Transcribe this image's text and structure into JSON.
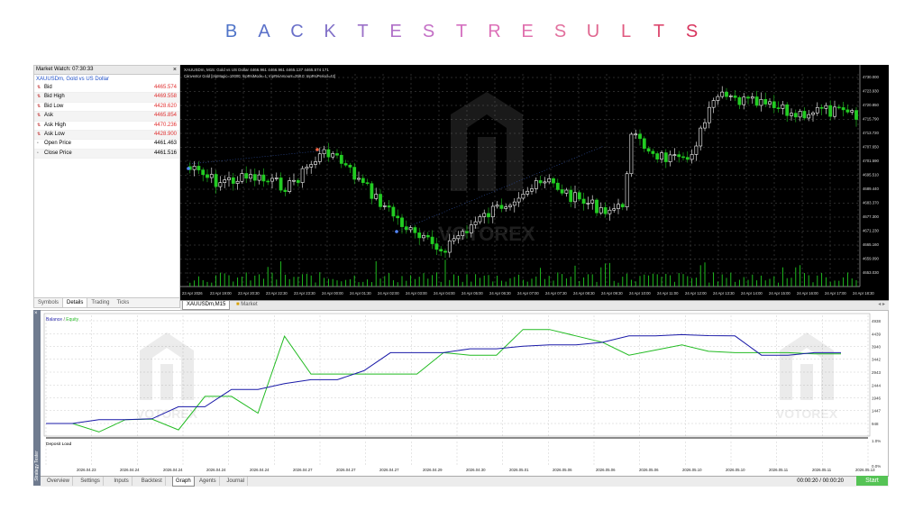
{
  "headline": "BACKTESTRESULTS",
  "headline_colors": [
    "#4f74c8",
    "#5a70c9",
    "#6a70c9",
    "#8170c8",
    "#9b70c8",
    "#b070c8",
    "#c470c6",
    "#d470c0",
    "#dc70b8",
    "#e070ae",
    "#e2709e",
    "#e06790",
    "#e05a80",
    "#dd4a70",
    "#d8355e"
  ],
  "market_watch": {
    "title": "Market Watch: 07:30:33",
    "close": "×",
    "symbol": "XAUUSDm, Gold vs US Dollar",
    "rows": [
      {
        "label": "Bid",
        "value": "4465.574",
        "red": true
      },
      {
        "label": "Bid High",
        "value": "4469.558",
        "red": true
      },
      {
        "label": "Bid Low",
        "value": "4428.620",
        "red": true
      },
      {
        "label": "Ask",
        "value": "4465.854",
        "red": true
      },
      {
        "label": "Ask High",
        "value": "4470.236",
        "red": true
      },
      {
        "label": "Ask Low",
        "value": "4428.900",
        "red": true
      },
      {
        "label": "Open Price",
        "value": "4461.463",
        "red": false
      },
      {
        "label": "Close Price",
        "value": "4461.516",
        "red": false
      }
    ],
    "tabs": [
      "Symbols",
      "Details",
      "Trading",
      "Ticks"
    ],
    "active_tab": 1
  },
  "chart": {
    "header_line1": "XAUUSDm, M15:  Gold vs US Dollar  4466.961 4466.961 4465.137 4465.574  171",
    "header_line2": "Canvestor Gold [InpMagic=10000; InpRsiMode=1; InpRsiAmount=258.0; InpRsiPeriod=42]",
    "price_labels": [
      "4730.000",
      "4723.930",
      "4720.850",
      "4715.790",
      "4713.720",
      "4707.650",
      "4701.590",
      "4695.510",
      "4689.440",
      "4683.370",
      "4677.300",
      "4671.230",
      "4665.160",
      "4659.090",
      "4653.030"
    ],
    "time_labels": [
      "23 Apr 2026",
      "23 Apr 19:00",
      "23 Apr 20:30",
      "23 Apr 22:30",
      "23 Apr 23:30",
      "24 Apr 00:00",
      "24 Apr 01:30",
      "24 Apr 02:00",
      "24 Apr 03:00",
      "24 Apr 04:00",
      "24 Apr 05:00",
      "24 Apr 06:30",
      "24 Apr 07:00",
      "24 Apr 07:30",
      "24 Apr 08:30",
      "24 Apr 09:30",
      "24 Apr 10:00",
      "24 Apr 11:00",
      "24 Apr 12:00",
      "24 Apr 13:30",
      "24 Apr 14:00",
      "24 Apr 15:00",
      "24 Apr 16:00",
      "24 Apr 17:00",
      "24 Apr 18:30"
    ],
    "tab_symbol": "XAUUSDm,M15",
    "tab_market": "Market",
    "watermark": "VOTOREX"
  },
  "tester": {
    "legend_balance": "Balance",
    "legend_sep": " / ",
    "legend_equity": "Equity",
    "deposit_load": "Deposit Load",
    "y_labels": [
      "4938",
      "4439",
      "3940",
      "3442",
      "2943",
      "2444",
      "1946",
      "1447",
      "948"
    ],
    "load_labels": [
      "1.0%",
      "0.0%"
    ],
    "dates": [
      "2026.04.23",
      "2026.04.24",
      "2026.04.24",
      "2026.04.24",
      "2026.04.24",
      "2026.04.27",
      "2026.04.27",
      "2026.04.27",
      "2026.04.29",
      "2026.04.30",
      "2026.05.01",
      "2026.05.06",
      "2026.05.06",
      "2026.05.06",
      "2026.05.10",
      "2026.05.10",
      "2026.05.11",
      "2026.05.11",
      "2026.05.13"
    ],
    "balance": [
      948,
      948,
      1100,
      1100,
      1130,
      1600,
      1600,
      2270,
      2270,
      2500,
      2650,
      2650,
      3000,
      3700,
      3700,
      3700,
      3850,
      3850,
      3950,
      4000,
      4000,
      4100,
      4350,
      4350,
      4400,
      4360,
      4350,
      3600,
      3600,
      3700,
      3700
    ],
    "equity": [
      948,
      948,
      620,
      1100,
      1120,
      700,
      2000,
      2000,
      1350,
      4340,
      2870,
      2870,
      2870,
      2870,
      2870,
      3700,
      3600,
      3600,
      4600,
      4600,
      4350,
      4100,
      3600,
      3800,
      4000,
      3750,
      3700,
      3700,
      3700,
      3650,
      3650
    ],
    "tabs": [
      "Overview",
      "Settings",
      "Inputs",
      "Backtest",
      "Graph",
      "Agents",
      "Journal"
    ],
    "active_tab": 4,
    "timer": "00:00:20 / 00:00:20",
    "start": "Start",
    "sidebar_label": "Strategy Tester",
    "close": "×",
    "watermark": "VOTOREX"
  },
  "colors": {
    "balance": "#1a1aa8",
    "equity": "#22bb22",
    "bull": "#ffffff",
    "bear": "#22cc22"
  }
}
